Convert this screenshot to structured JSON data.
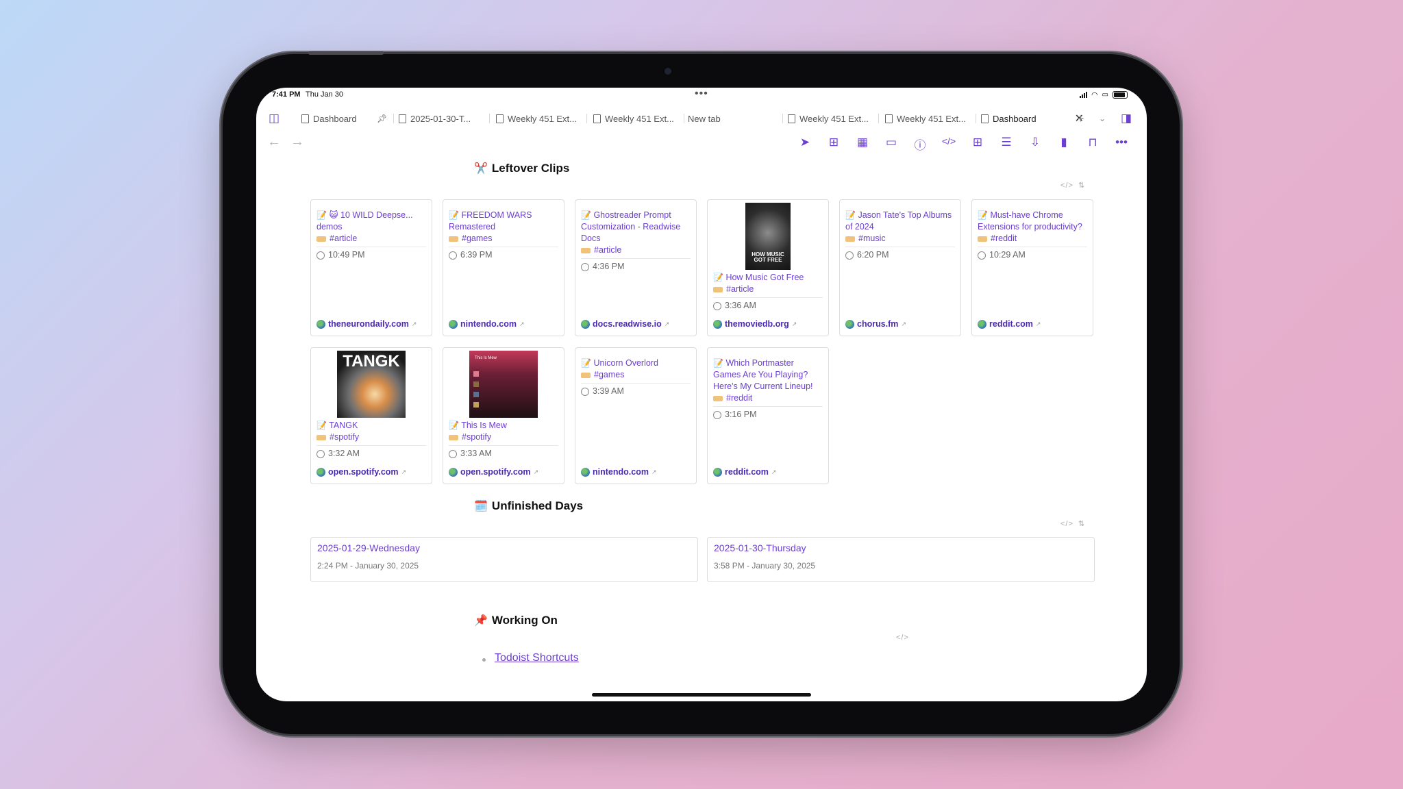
{
  "status": {
    "time": "7:41 PM",
    "date": "Thu Jan 30"
  },
  "tabs": [
    {
      "label": "Dashboard"
    },
    {
      "label": "2025-01-30-T..."
    },
    {
      "label": "Weekly 451 Ext..."
    },
    {
      "label": "Weekly 451 Ext..."
    },
    {
      "label": "New tab"
    },
    {
      "label": "Weekly 451 Ext..."
    },
    {
      "label": "Weekly 451 Ext..."
    },
    {
      "label": "Dashboard"
    }
  ],
  "toolbar_icons": [
    "send-icon",
    "new-note-icon",
    "calendar-icon",
    "folder-icon",
    "info-icon",
    "code-icon",
    "grid-icon",
    "checklist-icon",
    "export-icon",
    "bookmark-icon",
    "reading-icon",
    "more-icon"
  ],
  "sections": {
    "clips_title": "Leftover Clips",
    "days_title": "Unfinished Days",
    "working_title": "Working On"
  },
  "clips": [
    {
      "title": "😺 10 WILD Deepse... demos",
      "tag": "#article",
      "time": "10:49 PM",
      "site": "theneurondaily.com"
    },
    {
      "title": "FREEDOM WARS Remastered",
      "tag": "#games",
      "time": "6:39 PM",
      "site": "nintendo.com"
    },
    {
      "title": "Ghostreader Prompt Customization - Readwise Docs",
      "tag": "#article",
      "time": "4:36 PM",
      "site": "docs.readwise.io"
    },
    {
      "title": "How Music Got Free",
      "tag": "#article",
      "time": "3:36 AM",
      "site": "themoviedb.org",
      "thumb_text": "HOW MUSIC GOT FREE"
    },
    {
      "title": "Jason Tate's Top Albums of 2024",
      "tag": "#music",
      "time": "6:20 PM",
      "site": "chorus.fm"
    },
    {
      "title": "Must-have Chrome Extensions for productivity?",
      "tag": "#reddit",
      "time": "10:29 AM",
      "site": "reddit.com"
    },
    {
      "title": "TANGK",
      "tag": "#spotify",
      "time": "3:32 AM",
      "site": "open.spotify.com",
      "thumb_text": "TANGK"
    },
    {
      "title": "This Is Mew",
      "tag": "#spotify",
      "time": "3:33 AM",
      "site": "open.spotify.com",
      "thumb_text": "This Is Mew"
    },
    {
      "title": "Unicorn Overlord",
      "tag": "#games",
      "time": "3:39 AM",
      "site": "nintendo.com"
    },
    {
      "title": "Which Portmaster Games Are You Playing? Here's My Current Lineup!",
      "tag": "#reddit",
      "time": "3:16 PM",
      "site": "reddit.com"
    }
  ],
  "days": [
    {
      "title": "2025-01-29-Wednesday",
      "meta": "2:24 PM - January 30, 2025"
    },
    {
      "title": "2025-01-30-Thursday",
      "meta": "3:58 PM - January 30, 2025"
    }
  ],
  "working": [
    {
      "label": "Todoist Shortcuts"
    }
  ],
  "colors": {
    "accent": "#6b3fd1",
    "border": "#dcdcdc"
  }
}
